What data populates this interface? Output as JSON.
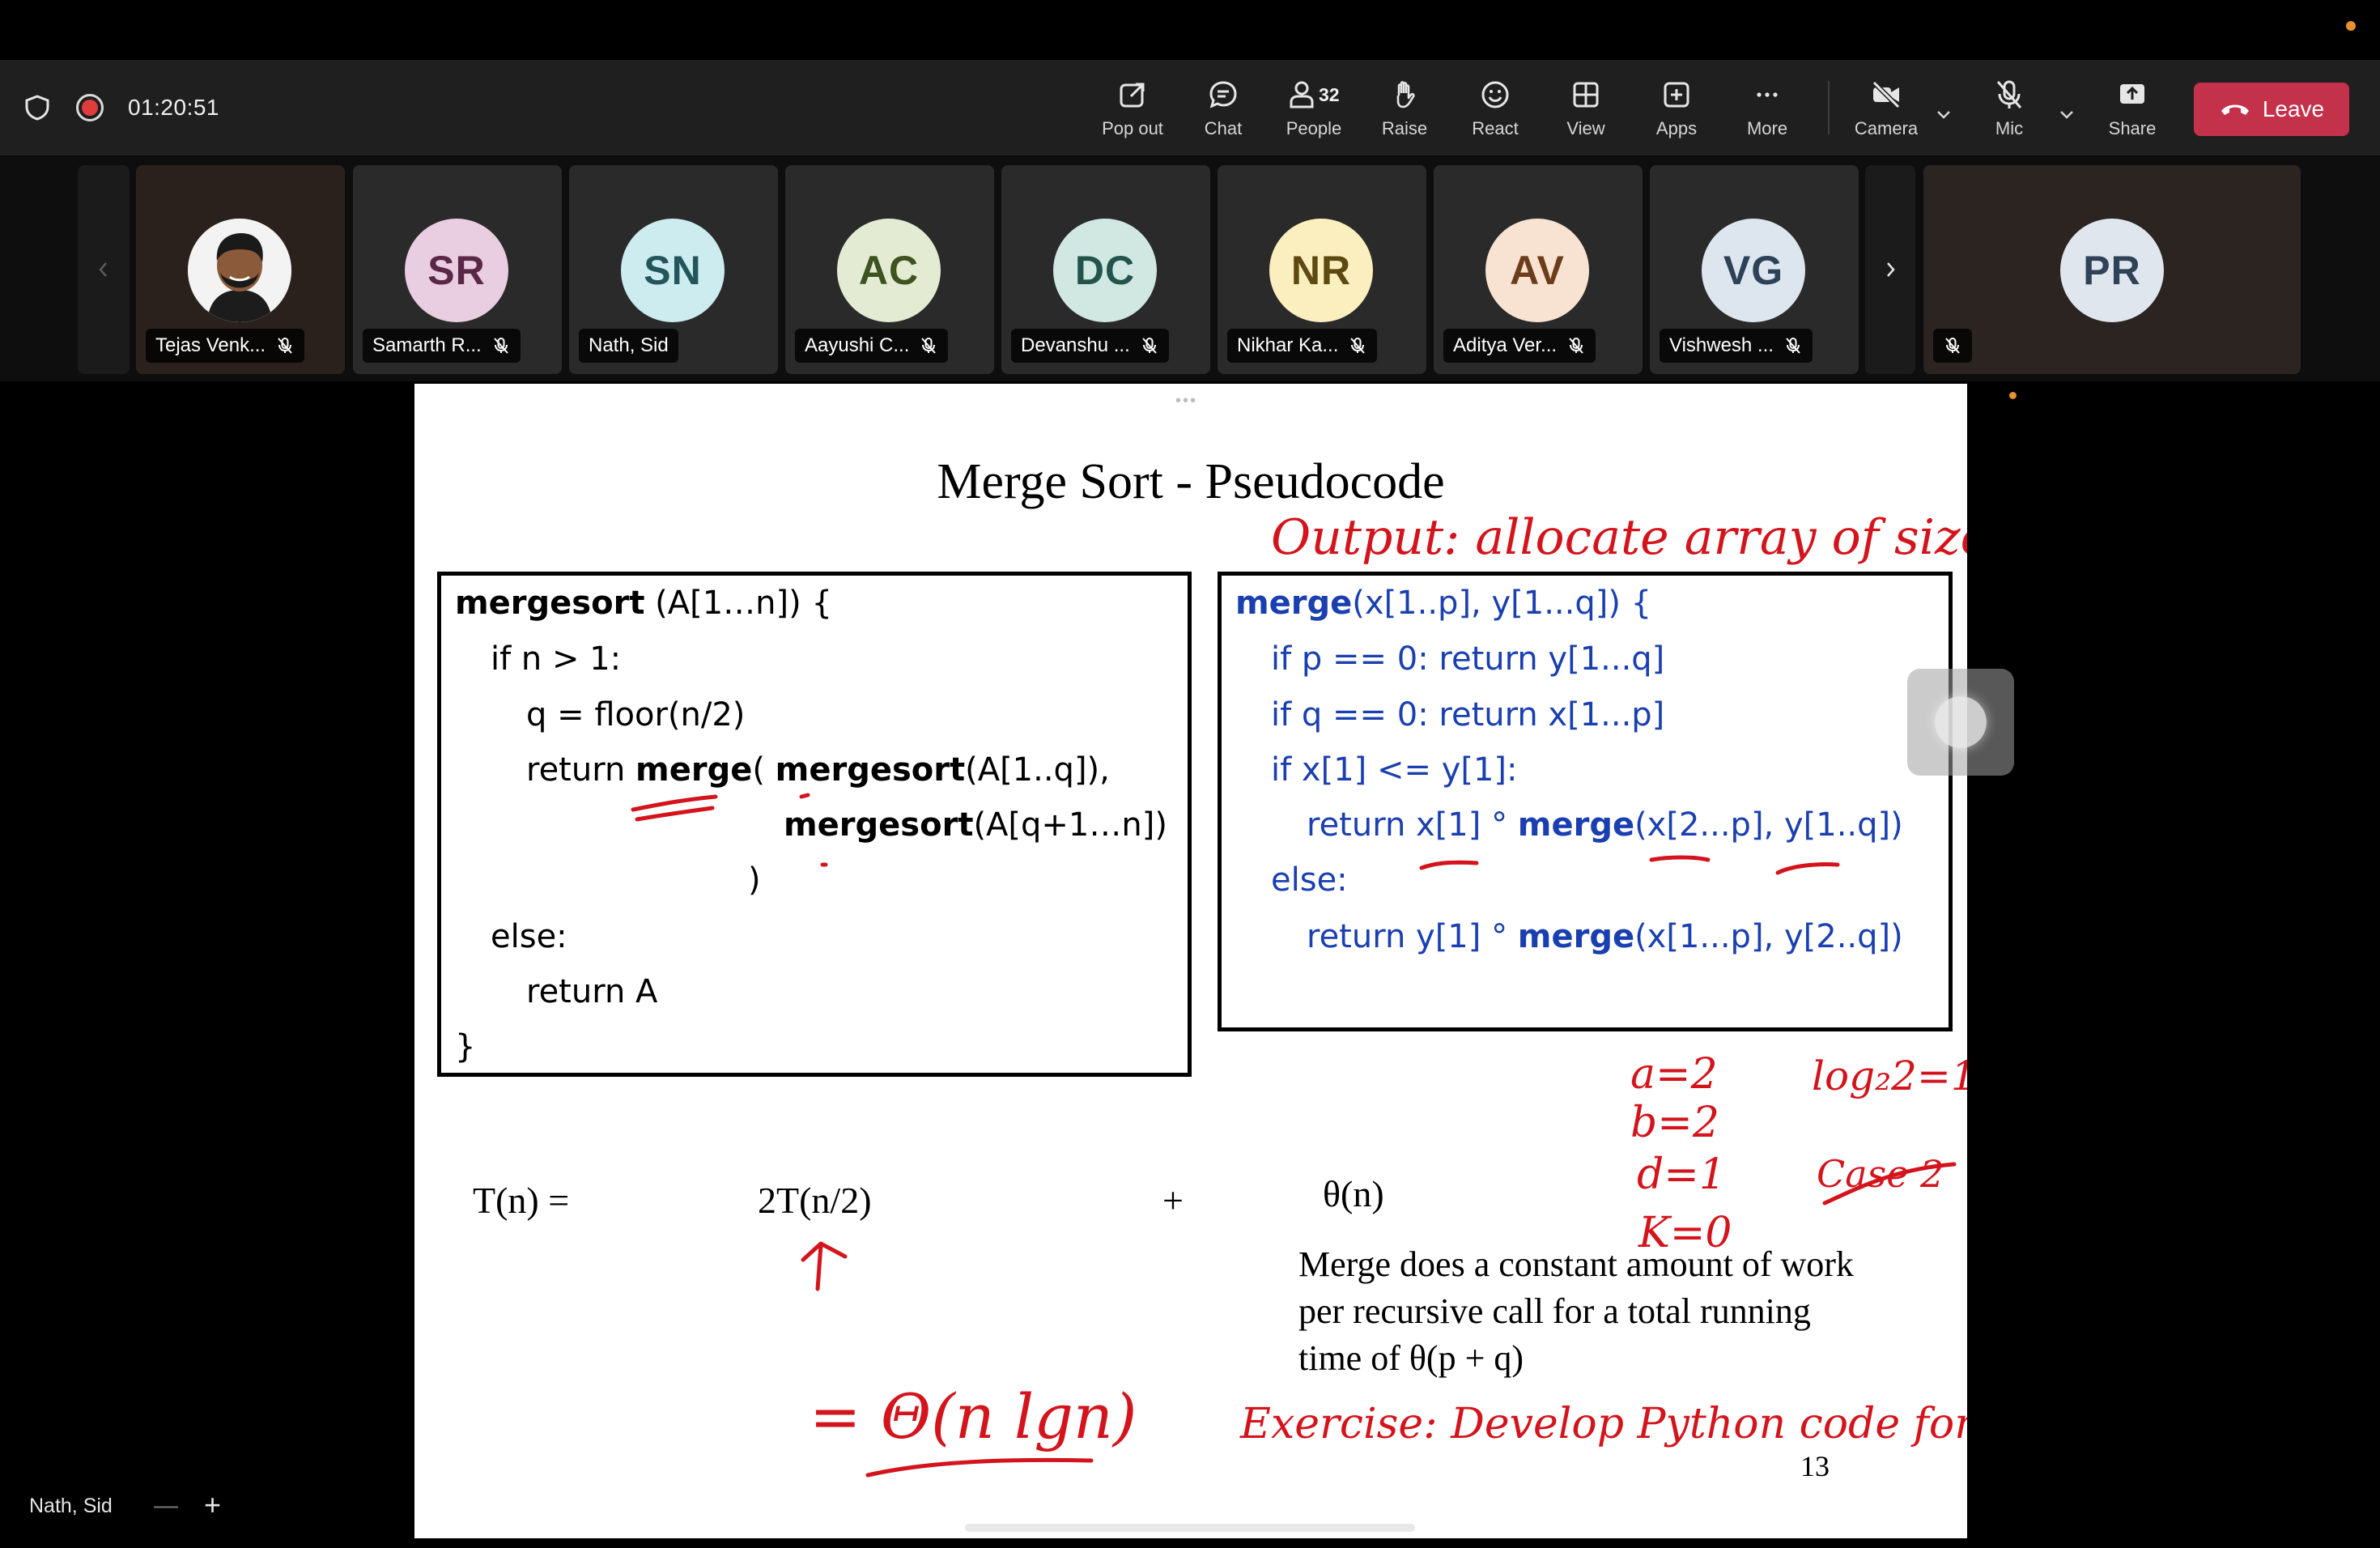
{
  "meeting": {
    "timer": "01:20:51",
    "accent_leave": "#c4314b",
    "recording_color": "#e03c3c"
  },
  "toolbar": {
    "pop_out": "Pop out",
    "chat": "Chat",
    "people": "People",
    "people_count": "32",
    "raise": "Raise",
    "react": "React",
    "view": "View",
    "apps": "Apps",
    "more": "More",
    "camera": "Camera",
    "mic": "Mic",
    "share": "Share",
    "leave": "Leave"
  },
  "participants": [
    {
      "initials": "",
      "name": "Tejas Venk...",
      "icon": "photo-avatar"
    },
    {
      "initials": "SR",
      "name": "Samarth R...",
      "bg": "#e9cde0",
      "fg": "#5a2748"
    },
    {
      "initials": "SN",
      "name": "Nath, Sid",
      "bg": "#cdecef",
      "fg": "#23565c"
    },
    {
      "initials": "AC",
      "name": "Aayushi C...",
      "bg": "#e3ecd3",
      "fg": "#3f5320"
    },
    {
      "initials": "DC",
      "name": "Devanshu ...",
      "bg": "#d1e7e2",
      "fg": "#22544c"
    },
    {
      "initials": "NR",
      "name": "Nikhar Ka...",
      "bg": "#fbeebf",
      "fg": "#5c4a10"
    },
    {
      "initials": "AV",
      "name": "Aditya Ver...",
      "bg": "#f8e3d3",
      "fg": "#6d3d1b"
    },
    {
      "initials": "VG",
      "name": "Vishwesh ...",
      "bg": "#dde5ee",
      "fg": "#2d4259"
    },
    {
      "initials": "PR",
      "name": "",
      "bg": "#dfe6ee",
      "fg": "#2f4257"
    }
  ],
  "presenter": {
    "name": "Nath, Sid",
    "zoom_out": "—",
    "zoom_in": "+"
  },
  "slide": {
    "title": "Merge Sort - Pseudocode",
    "left_code": {
      "l1_kw": "mergesort",
      "l1_rest": " (A[1…n]) {",
      "l2": "if n > 1:",
      "l3": "q = floor(n/2)",
      "l4_pre": "return ",
      "l4_kw": "merge",
      "l4_mid": "(    ",
      "l4_kw2": "mergesort",
      "l4_rest": "(A[1..q]),",
      "l5_kw": "mergesort",
      "l5_rest": "(A[q+1…n])",
      "l6": ")",
      "l7": "else:",
      "l8": "return A",
      "l9": "}"
    },
    "right_code": {
      "l1_kw": "merge",
      "l1_rest": "(x[1..p], y[1...q]) {",
      "l2": "if p == 0: return y[1...q]",
      "l3": "if q == 0: return x[1...p]",
      "l4": "if x[1] <= y[1]:",
      "l5_pre": "return x[1] ° ",
      "l5_kw": "merge",
      "l5_rest": "(x[2...p], y[1..q])",
      "l6": "else:",
      "l7_pre": "return y[1] ° ",
      "l7_kw": "merge",
      "l7_rest": "(x[1...p], y[2..q])"
    },
    "recurrence": {
      "lhs": "T(n) =",
      "term1": "2T(n/2)",
      "plus": "+",
      "term2": "θ(n)"
    },
    "explanation": [
      "Merge does a constant amount of work",
      "per recursive call for a total running",
      "time of θ(p + q)"
    ],
    "page_number": "13",
    "ink_color": "#d4141c",
    "annotations": {
      "output_note": "Output: allocate array of size n",
      "a": "a=2",
      "b": "b=2",
      "d": "d=1",
      "k": "K=0",
      "log": "log₂2=1",
      "case": "Case 2",
      "result": "= Θ(n lgn)",
      "exercise": "Exercise: Develop Python code for above"
    }
  }
}
